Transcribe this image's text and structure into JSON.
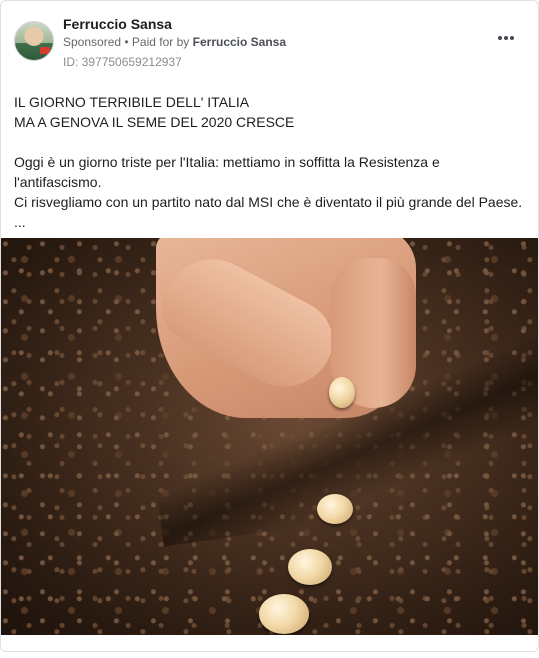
{
  "post": {
    "author": "Ferruccio Sansa",
    "sponsored_label": "Sponsored",
    "paid_prefix": "• Paid for by",
    "paid_by": "Ferruccio Sansa",
    "id_label": "ID: 397750659212937",
    "text": {
      "line1": "IL GIORNO TERRIBILE DELL' ITALIA",
      "line2": "MA A GENOVA IL SEME DEL 2020 CRESCE",
      "line3": "Oggi è un giorno triste per l'Italia: mettiamo in soffitta la Resistenza e",
      "line4": "l'antifascismo.",
      "line5": "Ci risvegliamo con un partito nato dal MSI che è diventato il più grande del Paese.",
      "line6": "..."
    }
  },
  "icons": {
    "more": "more-options-icon",
    "avatar": "profile-avatar"
  },
  "colors": {
    "text": "#1c1e21",
    "meta": "#65676b",
    "border": "#dddfe2"
  }
}
